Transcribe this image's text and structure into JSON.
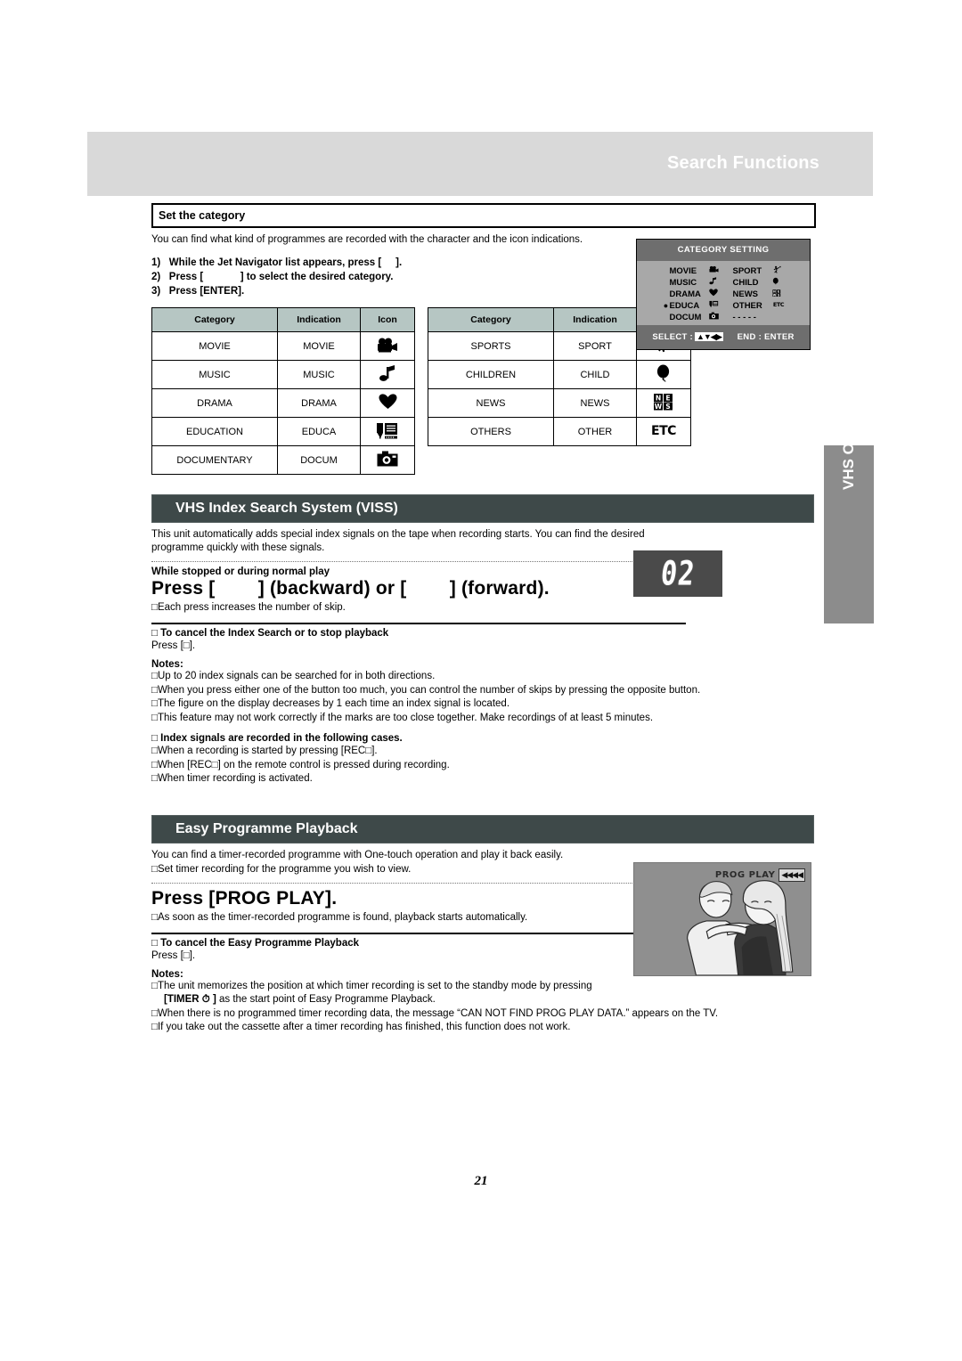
{
  "header": {
    "title": "Search Functions"
  },
  "side_tab": {
    "label": "VHS Operations"
  },
  "set_category": {
    "box_title": "Set the category",
    "intro": "You can find what kind of programmes are recorded with the character and the icon indications.",
    "steps": [
      "1)   While the Jet Navigator list appears, press [     ].",
      "2)   Press [             ] to select the desired category.",
      "3)   Press [ENTER]."
    ],
    "table_headers": [
      "Category",
      "Indication",
      "Icon"
    ],
    "table_left": [
      {
        "category": "MOVIE",
        "indication": "MOVIE",
        "icon": "movie-camera-icon",
        "glyph": "🎥"
      },
      {
        "category": "MUSIC",
        "indication": "MUSIC",
        "icon": "music-note-icon",
        "glyph": "♫"
      },
      {
        "category": "DRAMA",
        "indication": "DRAMA",
        "icon": "heart-icon",
        "glyph": "♥"
      },
      {
        "category": "EDUCATION",
        "indication": "EDUCA",
        "icon": "pen-and-book-icon",
        "glyph": "✎🗎"
      },
      {
        "category": "DOCUMENTARY",
        "indication": "DOCUM",
        "icon": "camera-icon",
        "glyph": "📷"
      }
    ],
    "table_right": [
      {
        "category": "SPORTS",
        "indication": "SPORT",
        "icon": "soccer-player-icon",
        "glyph": "⚽"
      },
      {
        "category": "CHILDREN",
        "indication": "CHILD",
        "icon": "balloon-icon",
        "glyph": "🎈"
      },
      {
        "category": "NEWS",
        "indication": "NEWS",
        "icon": "news-text-icon",
        "glyph": "NE\nWS"
      },
      {
        "category": "OTHERS",
        "indication": "OTHER",
        "icon": "etc-text-icon",
        "glyph": "ETC"
      }
    ]
  },
  "osd_category_setting": {
    "title": "CATEGORY SETTING",
    "left_items": [
      {
        "bullet": "",
        "label": "MOVIE",
        "glyph": "🎥"
      },
      {
        "bullet": "",
        "label": "MUSIC",
        "glyph": "♫"
      },
      {
        "bullet": "",
        "label": "DRAMA",
        "glyph": "♥"
      },
      {
        "bullet": "●",
        "label": "EDUCA",
        "glyph": "✎"
      },
      {
        "bullet": "",
        "label": "DOCUM",
        "glyph": "📷"
      }
    ],
    "right_items": [
      {
        "bullet": "",
        "label": "SPORT",
        "glyph": "⚽"
      },
      {
        "bullet": "",
        "label": "CHILD",
        "glyph": "🎈"
      },
      {
        "bullet": "",
        "label": "NEWS",
        "glyph": "NE"
      },
      {
        "bullet": "",
        "label": "OTHER",
        "glyph": "ETC"
      },
      {
        "bullet": "",
        "label": "- - - - -",
        "glyph": ""
      }
    ],
    "footer_select": "SELECT :",
    "footer_select_arrows": "▲▼◀▶",
    "footer_end": "END : ENTER"
  },
  "viss": {
    "section_title": "VHS Index Search System (VISS)",
    "intro": "This unit automatically adds special index signals on the tape when recording starts. You can find the desired programme quickly with these signals.",
    "condition": "While stopped or during normal play",
    "press_line": "Press [        ] (backward) or [        ] (forward).",
    "press_note": "□Each press increases the number of skip.",
    "cancel_head": "□  To cancel the Index Search or to stop playback",
    "cancel_text": "Press [□].",
    "notes_label": "Notes:",
    "notes": [
      "□Up to 20 index signals can be searched for in both directions.",
      "□When you press either one of the button too much, you can control the number of skips by pressing the opposite button.",
      "□The figure on the display decreases by 1 each time an index signal is located.",
      "□This feature may not work correctly if the marks are too close together. Make recordings of at least 5 minutes."
    ],
    "index_cases_head": "□  Index signals are recorded in the following cases.",
    "index_cases": [
      "□When a recording is started by pressing [REC□].",
      "□When [REC□] on the remote control is pressed during recording.",
      "□When timer recording is activated."
    ],
    "display_value": "02"
  },
  "easy_playback": {
    "section_title": "Easy Programme Playback",
    "intro": "You can find a timer-recorded programme with One-touch operation and play it back easily.",
    "intro2": "□Set timer recording for the programme you wish to view.",
    "press_line": "Press [PROG PLAY].",
    "press_note": "□As soon as the timer-recorded programme is found, playback starts automatically.",
    "cancel_head": "□  To cancel the Easy Programme Playback",
    "cancel_text": "Press [□].",
    "notes_label": "Notes:",
    "notes": [
      "□The unit memorizes the position at which timer recording is set to the standby mode by pressing",
      "[TIMER ⏱ ] as the start point of Easy Programme Playback.",
      "□When there is no programmed timer recording data, the message “CAN NOT FIND PROG PLAY DATA.” appears on the TV.",
      "□If you take out the cassette after a timer recording has finished, this function does not work."
    ],
    "figure_label": "PROG PLAY",
    "figure_arrows": "◀◀◀◀"
  },
  "page_number": "21",
  "colors": {
    "header_band": "#d9d9d9",
    "section_bar": "#3e4949",
    "table_header": "#b6c6c3",
    "side_tab": "#8c8c8c",
    "osd_panel": "#6e6e6e",
    "osd_body": "#a8a8a8"
  }
}
